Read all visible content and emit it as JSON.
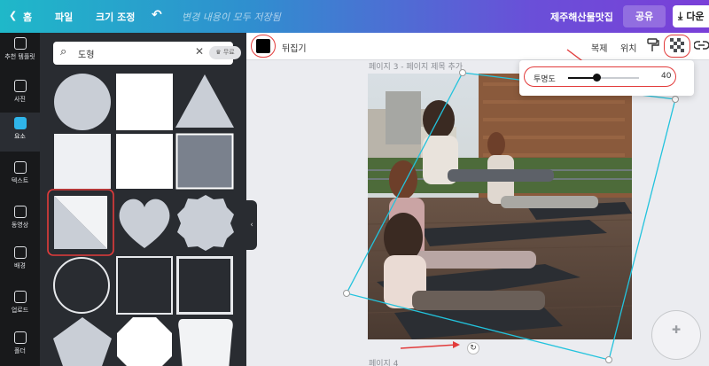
{
  "topbar": {
    "home_label": "홈",
    "file_label": "파일",
    "resize_label": "크기 조정",
    "saved_status": "변경 내용이 모두 저장됨",
    "title": "제주해산물맛집",
    "share_label": "공유",
    "download_label": "다운"
  },
  "leftnav": {
    "items": [
      {
        "label": "추천 템플릿",
        "icon": "template-icon"
      },
      {
        "label": "사진",
        "icon": "photo-icon"
      },
      {
        "label": "요소",
        "icon": "elements-icon"
      },
      {
        "label": "텍스트",
        "icon": "text-icon"
      },
      {
        "label": "동영상",
        "icon": "video-icon"
      },
      {
        "label": "배경",
        "icon": "background-icon"
      },
      {
        "label": "업로드",
        "icon": "upload-icon"
      },
      {
        "label": "폴더",
        "icon": "folder-icon"
      }
    ],
    "active_index": 2
  },
  "panel": {
    "search_value": "도형",
    "badge_label": "무료"
  },
  "toolbar": {
    "flip_label": "뒤집기",
    "duplicate_label": "복제",
    "position_label": "위치",
    "swatch_color": "#000000"
  },
  "canvas": {
    "page3_label": "페이지 3 - 페이지 제목 추가",
    "page4_label": "페이지 4"
  },
  "transparency": {
    "label": "투명도",
    "value": "40",
    "level_percent": 40
  },
  "colors": {
    "highlight_red": "#e23b3b",
    "selection_cyan": "#22c3dd",
    "accent": "#2fb5ea"
  }
}
